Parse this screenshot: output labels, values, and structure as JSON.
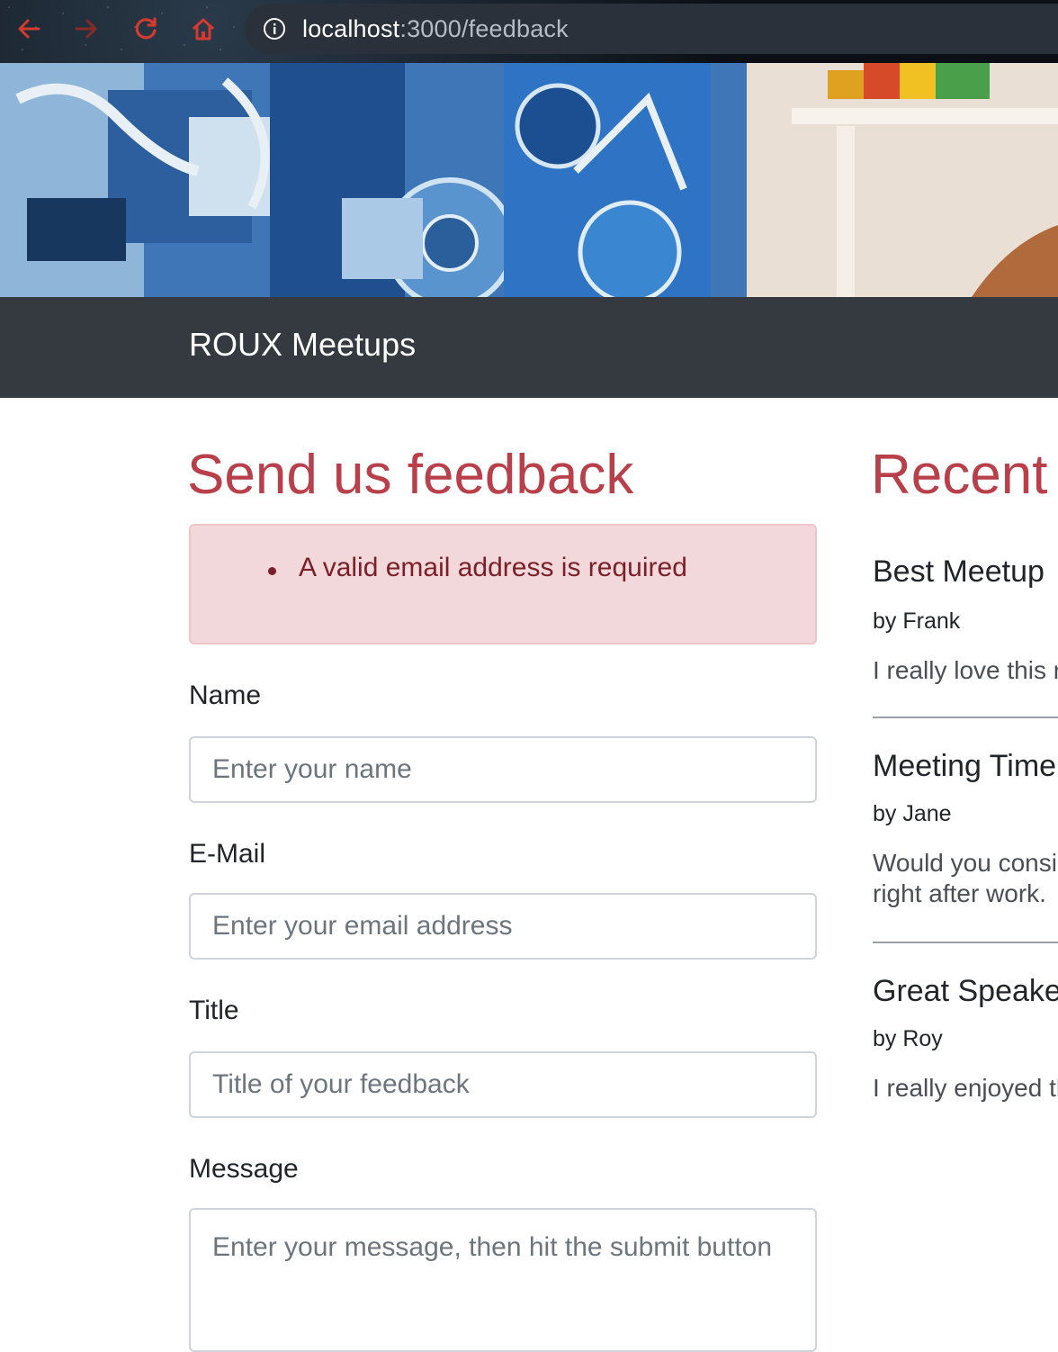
{
  "browser": {
    "url_host": "localhost",
    "url_path": ":3000/feedback"
  },
  "navbar": {
    "brand": "ROUX Meetups"
  },
  "form": {
    "title": "Send us feedback",
    "error_message": "A valid email address is required",
    "name_label": "Name",
    "name_placeholder": "Enter your name",
    "email_label": "E-Mail",
    "email_placeholder": "Enter your email address",
    "title_label": "Title",
    "title_placeholder": "Title of your feedback",
    "message_label": "Message",
    "message_placeholder": "Enter your message, then hit the submit button"
  },
  "recent": {
    "title": "Recent",
    "items": [
      {
        "title": "Best Meetup",
        "author": "by Frank",
        "text": "I really love this r"
      },
      {
        "title": "Meeting Time",
        "author": "by Jane",
        "text": "Would you consi right after work."
      },
      {
        "title": "Great Speake",
        "author": "by Roy",
        "text": "I really enjoyed th"
      }
    ]
  },
  "colors": {
    "accent": "#b9404a",
    "navbar_bg": "#343a40",
    "alert_bg": "#f2d8da",
    "alert_text": "#7c1f28",
    "browser_icons": "#d23b2f"
  }
}
